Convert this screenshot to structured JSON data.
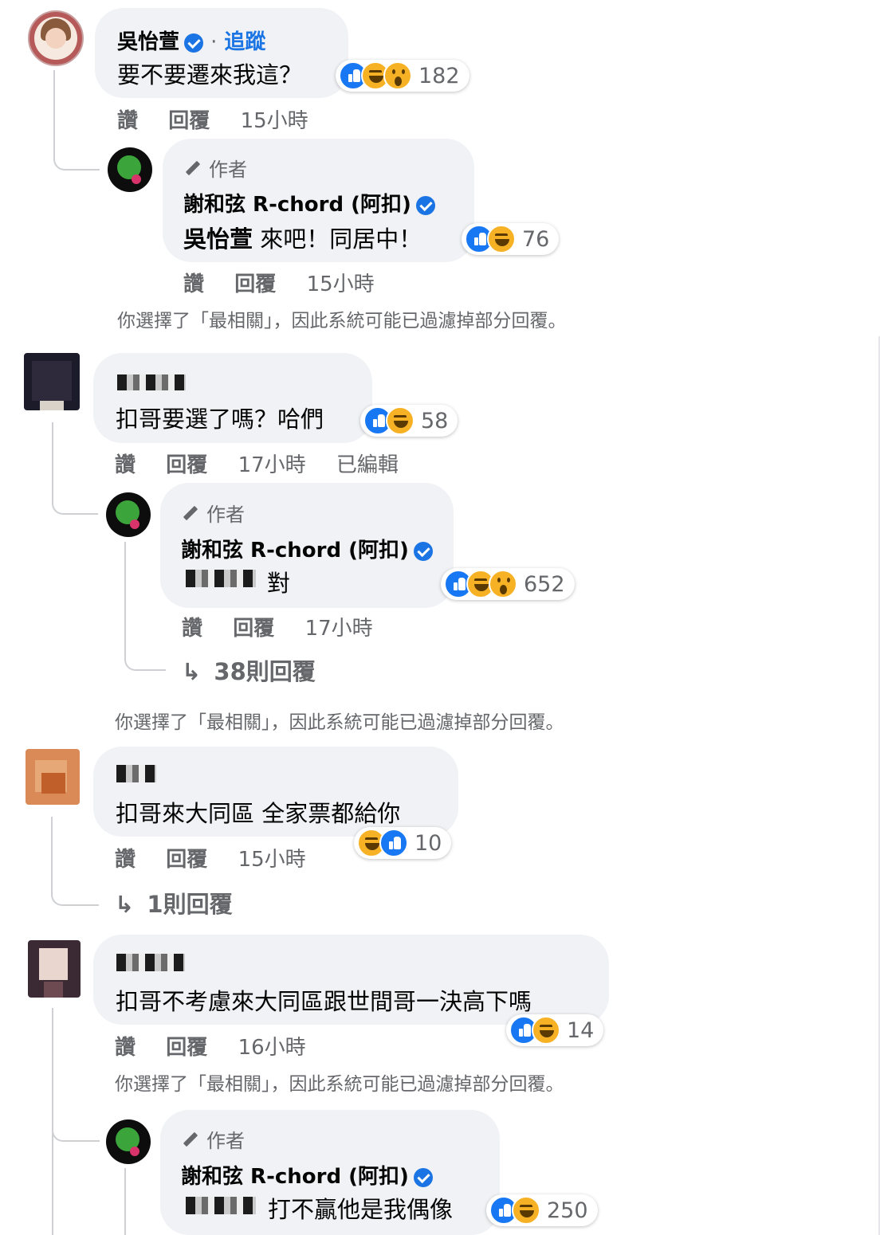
{
  "comments": [
    {
      "name": "吳怡萱",
      "follow_label": "追蹤",
      "dot": "·",
      "text": "要不要遷來我這？",
      "reactions": [
        "like-icon",
        "haha-icon",
        "wow-icon"
      ],
      "reaction_count": "182",
      "like_label": "讚",
      "reply_label": "回覆",
      "time": "15小時",
      "reply": {
        "author_tag": "作者",
        "name": "謝和弦 R-chord (阿扣)",
        "mention": "吳怡萱",
        "text": "來吧！同居中！",
        "reactions": [
          "like-icon",
          "haha-icon"
        ],
        "reaction_count": "76",
        "like_label": "讚",
        "reply_label": "回覆",
        "time": "15小時"
      },
      "notice": "你選擇了「最相關」，因此系統可能已過濾掉部分回覆。"
    },
    {
      "text": "扣哥要選了嗎？哈們",
      "reactions": [
        "like-icon",
        "haha-icon"
      ],
      "reaction_count": "58",
      "like_label": "讚",
      "reply_label": "回覆",
      "time": "17小時",
      "edited": "已編輯",
      "reply": {
        "author_tag": "作者",
        "name": "謝和弦 R-chord (阿扣)",
        "text": "對",
        "reactions": [
          "like-icon",
          "haha-icon",
          "wow-icon"
        ],
        "reaction_count": "652",
        "like_label": "讚",
        "reply_label": "回覆",
        "time": "17小時"
      },
      "more_replies": "38則回覆",
      "notice": "你選擇了「最相關」，因此系統可能已過濾掉部分回覆。"
    },
    {
      "text": "扣哥來大同區 全家票都給你",
      "reactions": [
        "haha-icon",
        "like-icon"
      ],
      "reaction_count": "10",
      "like_label": "讚",
      "reply_label": "回覆",
      "time": "15小時",
      "more_replies": "1則回覆"
    },
    {
      "text": "扣哥不考慮來大同區跟世間哥一決高下嗎",
      "reactions": [
        "like-icon",
        "haha-icon"
      ],
      "reaction_count": "14",
      "like_label": "讚",
      "reply_label": "回覆",
      "time": "16小時",
      "notice": "你選擇了「最相關」，因此系統可能已過濾掉部分回覆。",
      "reply": {
        "author_tag": "作者",
        "name": "謝和弦 R-chord (阿扣)",
        "text": "打不贏他是我偶像",
        "reactions": [
          "like-icon",
          "haha-icon"
        ],
        "reaction_count": "250"
      }
    }
  ],
  "colors": {
    "bubble": "#f0f2f5",
    "link": "#1b74e4",
    "meta": "#65676b",
    "like": "#1877f2",
    "haha": "#f7b125"
  }
}
